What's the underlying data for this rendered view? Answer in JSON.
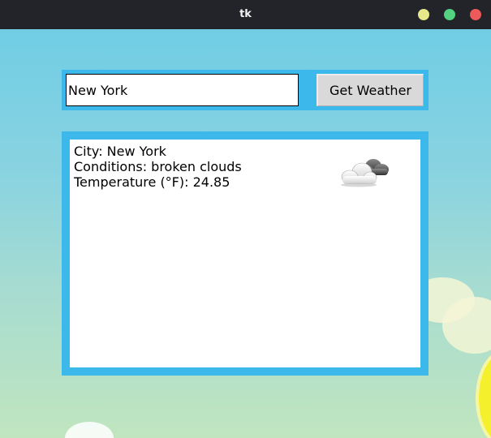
{
  "window": {
    "title": "tk"
  },
  "search": {
    "city_value": "New York",
    "button_label": "Get Weather"
  },
  "result": {
    "city_line": "City: New York",
    "conditions_line": "Conditions: broken clouds",
    "temperature_line": "Temperature (°F): 24.85",
    "icon": "broken-clouds-icon"
  },
  "colors": {
    "frame_accent": "#3cb9ea",
    "close_button": "#ed5a5a",
    "maximize_button": "#53d27f",
    "minimize_button": "#e6e98a"
  }
}
